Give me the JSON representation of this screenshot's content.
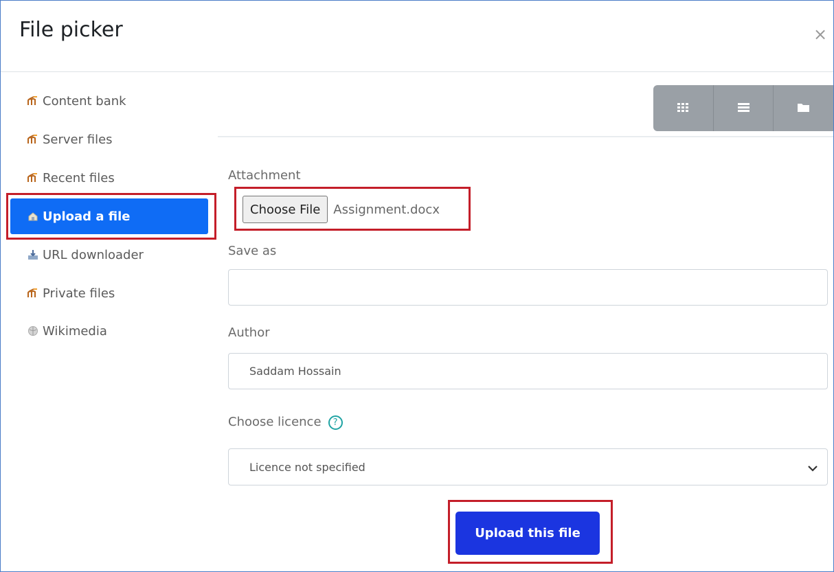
{
  "dialog": {
    "title": "File picker",
    "close_symbol": "×"
  },
  "sidebar": {
    "items": [
      {
        "label": "Content bank",
        "icon": "moodle-icon"
      },
      {
        "label": "Server files",
        "icon": "moodle-icon"
      },
      {
        "label": "Recent files",
        "icon": "moodle-icon"
      },
      {
        "label": "Upload a file",
        "icon": "upload-icon",
        "active": true
      },
      {
        "label": "URL downloader",
        "icon": "url-downloader-icon"
      },
      {
        "label": "Private files",
        "icon": "moodle-icon"
      },
      {
        "label": "Wikimedia",
        "icon": "wikimedia-icon"
      }
    ]
  },
  "view_toggle": {
    "icons": [
      "grid-view-icon",
      "list-view-icon",
      "folder-view-icon"
    ]
  },
  "form": {
    "attachment_label": "Attachment",
    "choose_file_label": "Choose File",
    "file_name": "Assignment.docx",
    "save_as_label": "Save as",
    "save_as_value": "",
    "author_label": "Author",
    "author_value": "Saddam Hossain",
    "licence_label": "Choose licence",
    "licence_help_symbol": "?",
    "licence_value": "Licence not specified",
    "upload_button": "Upload this file"
  },
  "colors": {
    "active_nav": "#0f6cf5",
    "upload_button": "#1b35e0",
    "highlight": "#c41e29"
  }
}
